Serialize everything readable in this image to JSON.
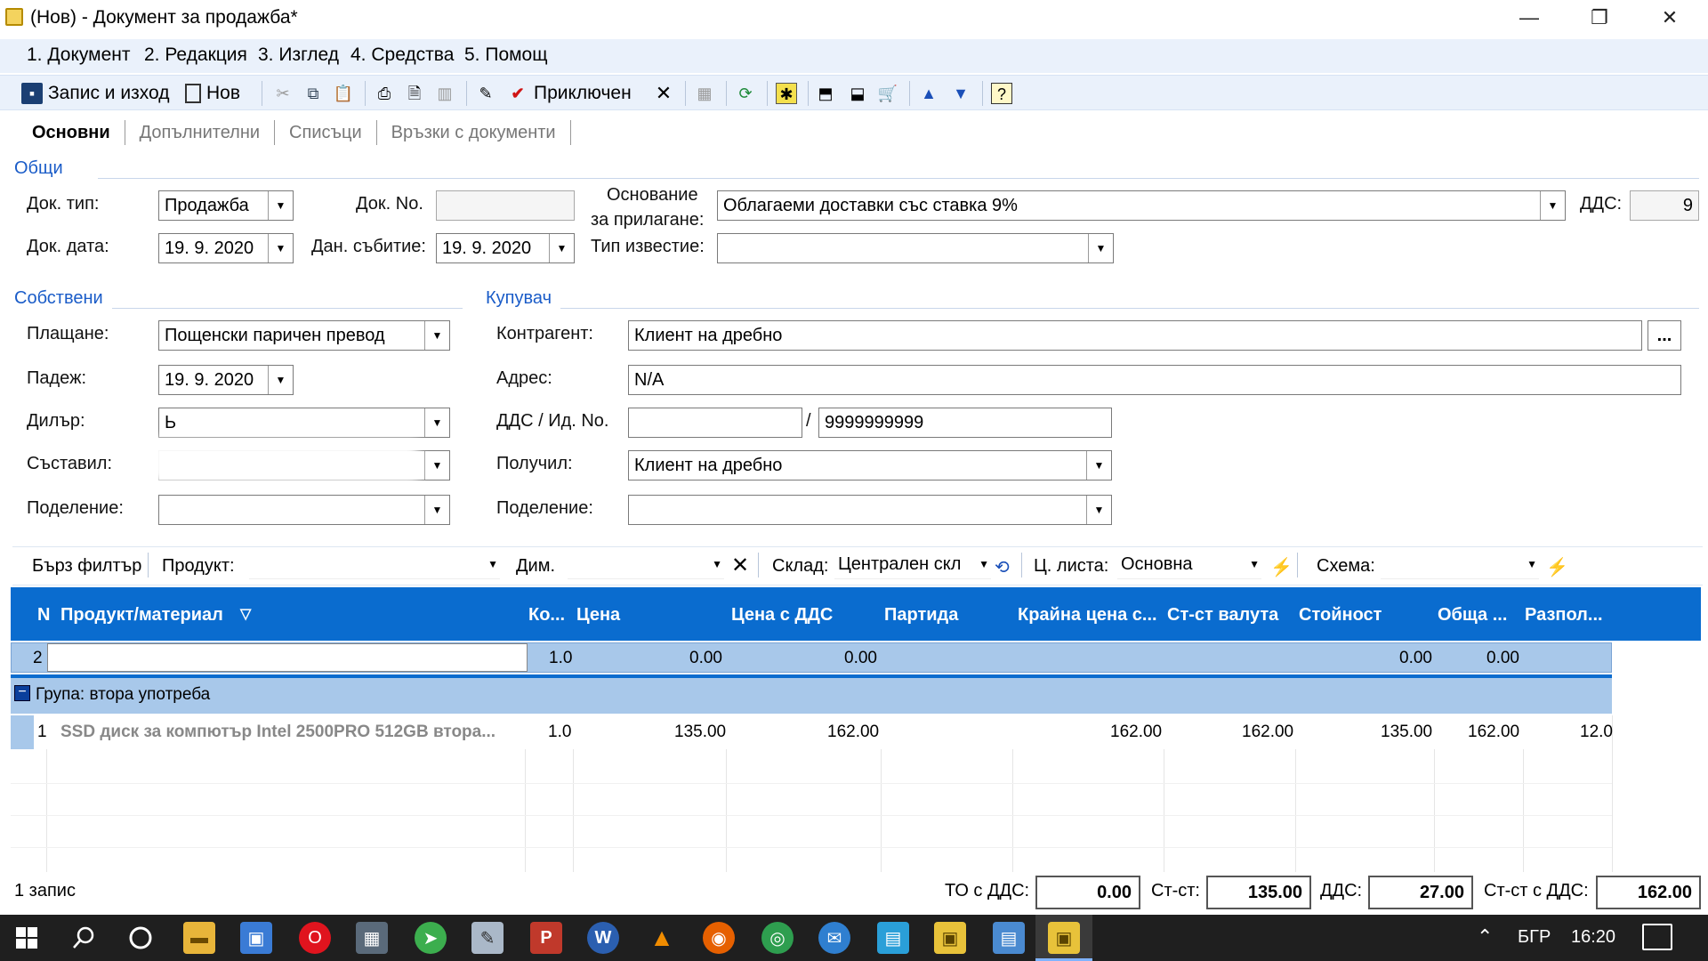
{
  "window": {
    "title": "(Нов) - Документ за продажба*",
    "min": "—",
    "restore": "❐",
    "close": "✕"
  },
  "menu": [
    "1. Документ",
    "2. Редакция",
    "3. Изглед",
    "4. Средства",
    "5. Помощ"
  ],
  "toolbar": {
    "save_exit": "Запис и изход",
    "new": "Нов",
    "closed": "Приключен"
  },
  "tabs": [
    "Основни",
    "Допълнителни",
    "Списъци",
    "Връзки с документи"
  ],
  "general": {
    "section": "Общи",
    "doc_type_label": "Док. тип:",
    "doc_type": "Продажба",
    "doc_no_label": "Док. No.",
    "doc_no": "",
    "basis_label_1": "Основание",
    "basis_label_2": "за прилагане:",
    "basis": "Облагаеми доставки със ставка 9%",
    "vat_label": "ДДС:",
    "vat": "9",
    "doc_date_label": "Док. дата:",
    "doc_date": "19.  9. 2020",
    "tax_event_label": "Дан. събитие:",
    "tax_event": "19.  9. 2020",
    "notice_label": "Тип известие:",
    "notice": ""
  },
  "own": {
    "section": "Собствени",
    "payment_label": "Плащане:",
    "payment": "Пощенски паричен превод",
    "due_label": "Падеж:",
    "due": "19.  9. 2020",
    "dealer_label": "Дилър:",
    "dealer": "Ь",
    "author_label": "Съставил:",
    "author": "",
    "division_label": "Поделение:",
    "division": ""
  },
  "buyer": {
    "section": "Купувач",
    "contractor_label": "Контрагент:",
    "contractor": "Клиент на дребно",
    "browse": "...",
    "address_label": "Адрес:",
    "address": "N/A",
    "vat_id_label": "ДДС / Ид. No.",
    "vat_no": "",
    "slash": "/",
    "id_no": "9999999999",
    "received_label": "Получил:",
    "received": "Клиент на дребно",
    "division_label": "Поделение:",
    "division": ""
  },
  "filter": {
    "quick": "Бърз филтър",
    "product_label": "Продукт:",
    "dim_label": "Дим.",
    "warehouse_label": "Склад:",
    "warehouse": "Централен скл",
    "pricelist_label": "Ц. листа:",
    "pricelist": "Основна",
    "schema_label": "Схема:"
  },
  "grid": {
    "columns": [
      "N",
      "Продукт/материал",
      "Ко...",
      "Цена",
      "Цена с ДДС",
      "Партида",
      "Крайна цена с...",
      "Ст-ст валута",
      "Стойност",
      "Обща ...",
      "Разпол..."
    ],
    "new_row": {
      "n": "2",
      "qty": "1.0",
      "price": "0.00",
      "price_vat": "0.00",
      "value": "0.00",
      "total": "0.00"
    },
    "group_label": "Група: втора употреба",
    "rows": [
      {
        "n": "1",
        "product": "SSD диск за компютър Intel 2500PRO 512GB втора...",
        "qty": "1.0",
        "price": "135.00",
        "price_vat": "162.00",
        "final": "162.00",
        "currency": "162.00",
        "value": "135.00",
        "total": "162.00",
        "avail": "12.0"
      }
    ]
  },
  "status": {
    "records": "1 запис",
    "to_vat_label": "ТО с ДДС:",
    "to_vat": "0.00",
    "value_label": "Ст-ст:",
    "value": "135.00",
    "vat_label": "ДДС:",
    "vat": "27.00",
    "total_label": "Ст-ст с ДДС:",
    "total": "162.00"
  },
  "taskbar": {
    "lang": "БГР",
    "time": "16:20"
  }
}
